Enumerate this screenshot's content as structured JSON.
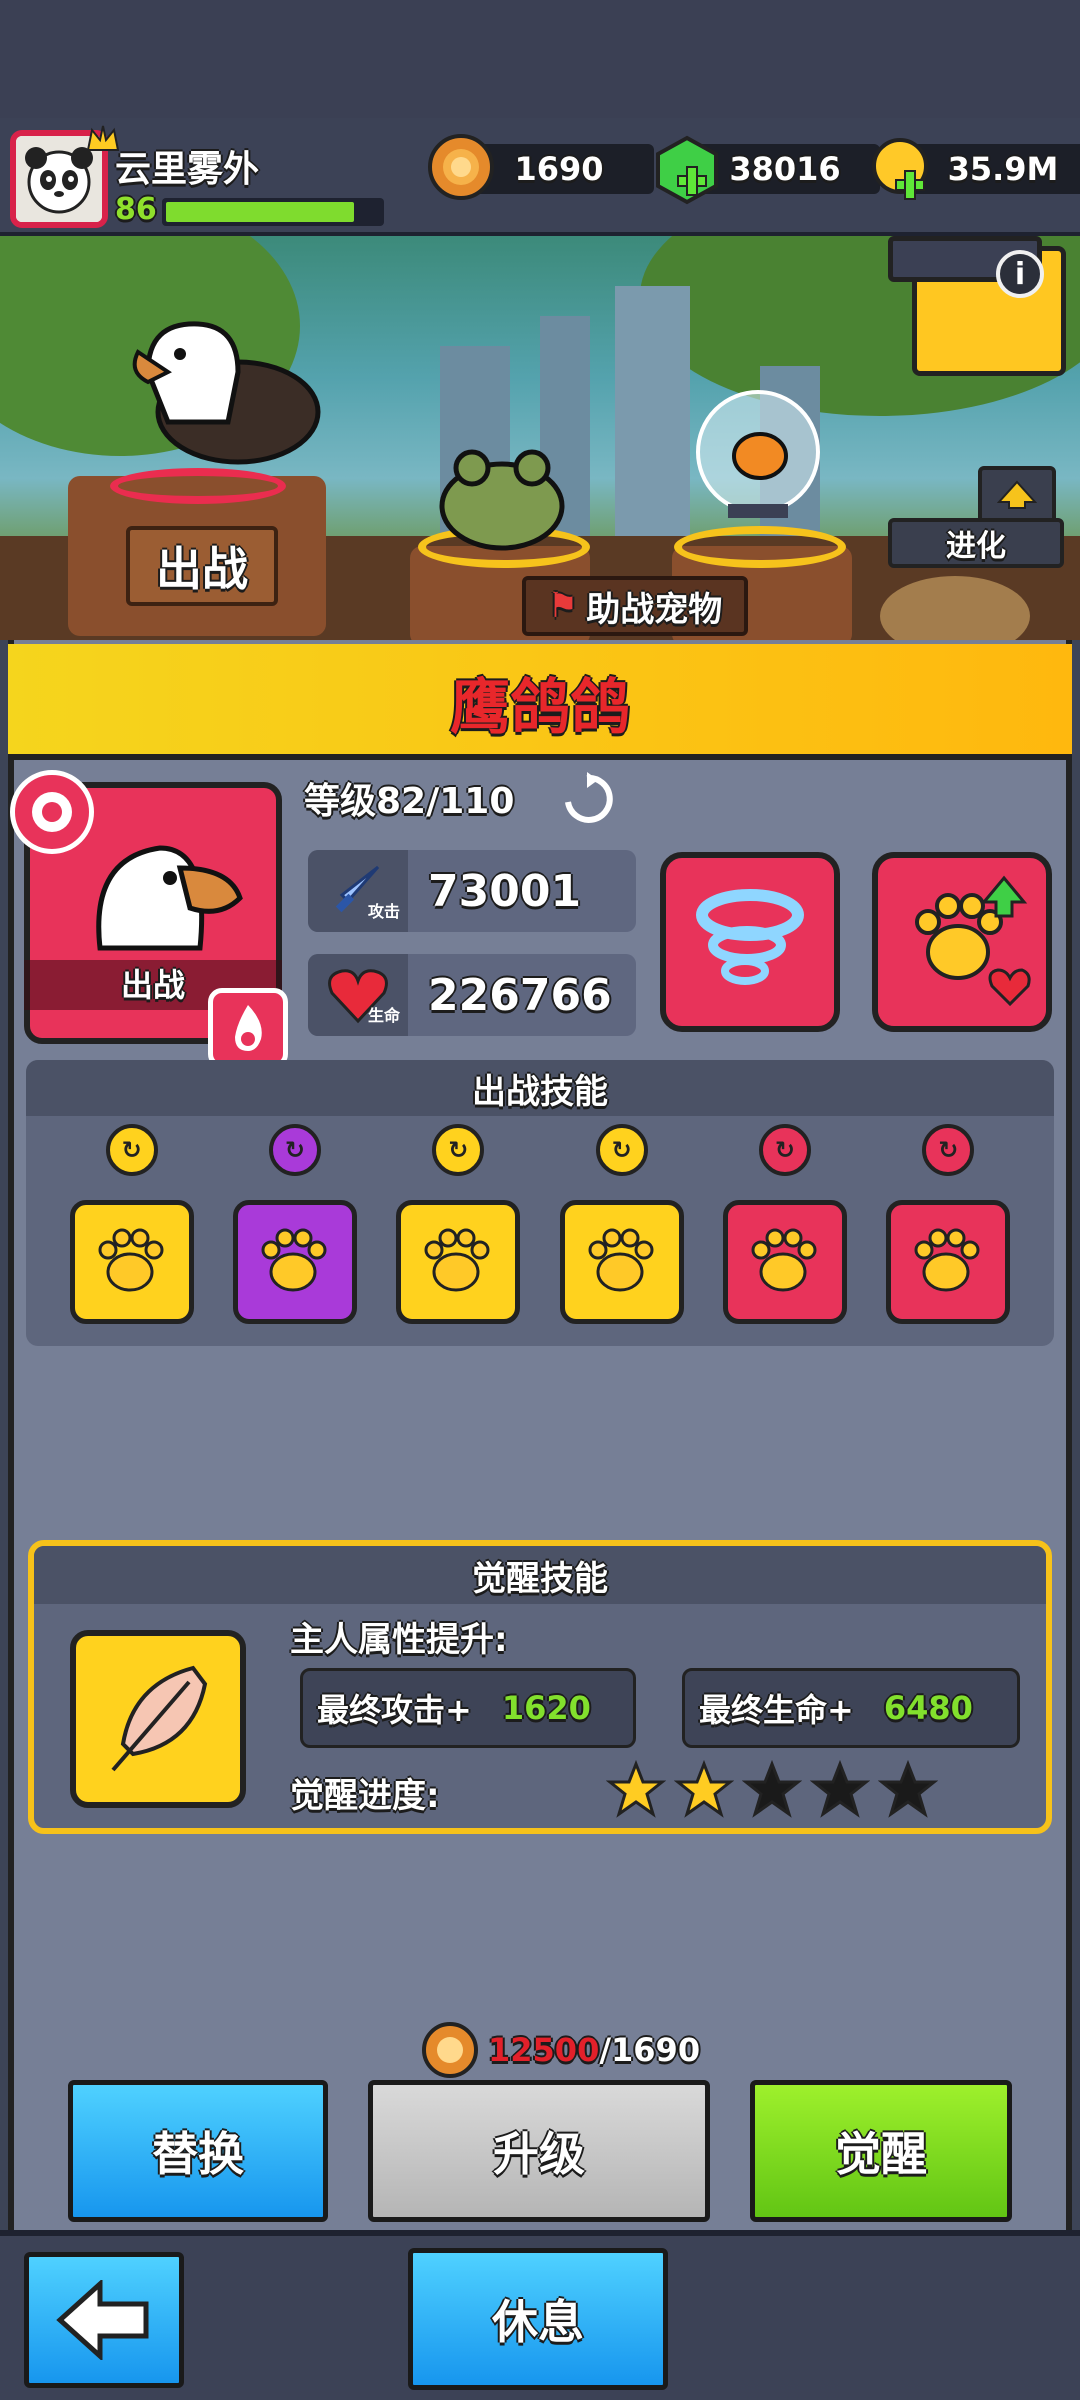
{
  "player": {
    "name": "云里雾外",
    "level": "86",
    "xp_fraction": 0.88
  },
  "currencies": [
    {
      "icon": "lion-coin-icon",
      "value": "1690"
    },
    {
      "icon": "green-gem-icon",
      "value": "38016"
    },
    {
      "icon": "gold-coin-icon",
      "value": "35.9M"
    }
  ],
  "scene": {
    "deploy_label": "出战",
    "support_label": "助战宠物",
    "evolve_label": "进化"
  },
  "pet": {
    "name": "鹰鸽鸽",
    "card_label": "出战",
    "level_text": "等级82/110",
    "attack_tag": "攻击",
    "attack": "73001",
    "hp_tag": "生命",
    "hp": "226766"
  },
  "skills": {
    "title": "出战技能",
    "items": [
      {
        "tile_color": "#ffd21e",
        "mini_color": "#ffd21e",
        "icon": "paw-cooldown-icon"
      },
      {
        "tile_color": "#a93ad9",
        "mini_color": "#a93ad9",
        "icon": "paw-fire-icon"
      },
      {
        "tile_color": "#ffd21e",
        "mini_color": "#ffd21e",
        "icon": "paw-heal-icon"
      },
      {
        "tile_color": "#ffd21e",
        "mini_color": "#ffd21e",
        "icon": "paw-crit-icon"
      },
      {
        "tile_color": "#e8335a",
        "mini_color": "#e8335a",
        "icon": "zombie-burn-icon"
      },
      {
        "tile_color": "#e8335a",
        "mini_color": "#e8335a",
        "icon": "chest-upgrade-icon"
      }
    ]
  },
  "awaken": {
    "title": "觉醒技能",
    "owner_label": "主人属性提升:",
    "atk_label": "最终攻击+",
    "atk_value": "1620",
    "hp_label": "最终生命+",
    "hp_value": "6480",
    "progress_label": "觉醒进度:",
    "stars_filled": 2,
    "stars_total": 5
  },
  "cost": {
    "need": "12500",
    "have": "/1690"
  },
  "buttons": {
    "replace": "替换",
    "upgrade": "升级",
    "awaken": "觉醒",
    "rest": "休息"
  }
}
